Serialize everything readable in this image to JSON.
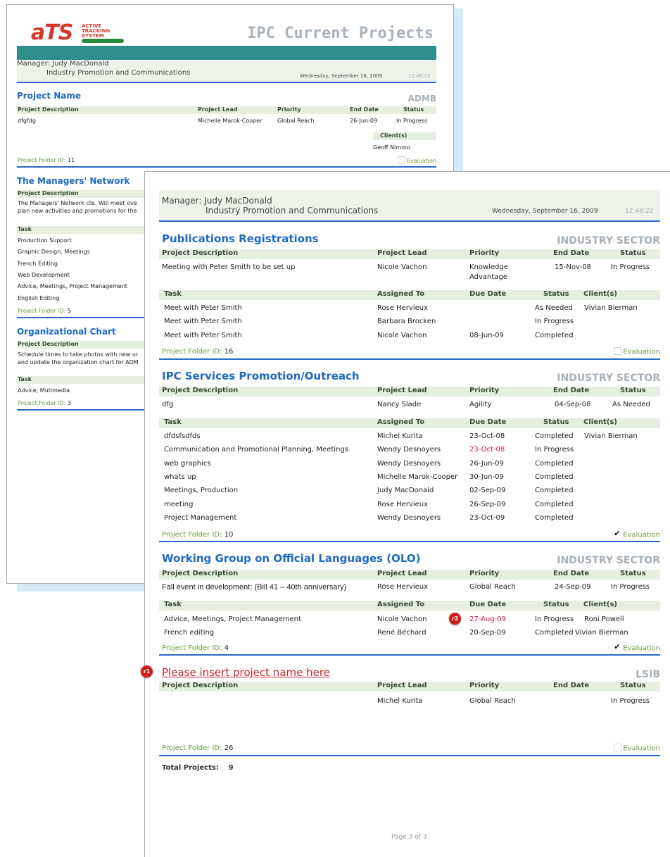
{
  "back": {
    "logo": {
      "brand": "aTS",
      "sub": [
        "ACTIVE",
        "TRACKING",
        "SYSTEM"
      ]
    },
    "title": "IPC Current Projects",
    "manager_label": "Manager:",
    "manager_name": "Judy MacDonald",
    "department": "Industry Promotion and Communications",
    "date": "Wednesday, September 16, 2009",
    "time": "12:48:15",
    "projects": [
      {
        "name": "Project Name",
        "sector": "ADMB",
        "headers": {
          "desc": "Project Description",
          "lead": "Project Lead",
          "priority": "Priority",
          "end": "End Date",
          "status": "Status"
        },
        "desc": "dfgfdg",
        "lead": "Michelle Marok-Cooper",
        "priority": "Global Reach",
        "end": "26-Jun-09",
        "status": "In Progress",
        "clients_label": "Client(s)",
        "client": "Geoff Nimmo",
        "folder_label": "Project Folder ID:",
        "folder": "11",
        "eval_label": "Evaluation"
      },
      {
        "name": "The Managers' Network",
        "desc_label": "Project Description",
        "desc": "The Managers' Network cte. Will meet ove",
        "desc2": "plan new activities and promotions for the",
        "task_label": "Task",
        "tasks": [
          "Production Support",
          "Graphic Design, Meetings",
          "French Editing",
          "Web Development",
          "Advice, Meetings, Project Management",
          "English Editing"
        ],
        "folder_label": "Project Folder ID:",
        "folder": "5"
      },
      {
        "name": "Organizational Chart",
        "desc_label": "Project Description",
        "desc": "Schedule times to take photos with new or",
        "desc2": "and update the organization chart for ADM",
        "task_label": "Task",
        "tasks": [
          "Advice, Mutimedia"
        ],
        "folder_label": "Project Folder ID:",
        "folder": "3"
      }
    ]
  },
  "front": {
    "manager_label": "Manager:",
    "manager_name": "Judy MacDonald",
    "department": "Industry Promotion and Communications",
    "date": "Wednesday, September 16, 2009",
    "time": "12:48:22",
    "headers": {
      "desc": "Project Description",
      "lead": "Project Lead",
      "priority": "Priority",
      "end": "End Date",
      "status": "Status"
    },
    "task_headers": {
      "task": "Task",
      "assigned": "Assigned To",
      "due": "Due Date",
      "status": "Status",
      "clients": "Client(s)"
    },
    "folder_label": "Project Folder ID:",
    "eval_label": "Evaluation",
    "p1": {
      "name": "Publications Registrations",
      "sector": "INDUSTRY SECTOR",
      "desc": "Meeting with Peter Smith to be set up",
      "lead": "Nicole Vachon",
      "priority": "Knowledge",
      "priority2": "Advantage",
      "end": "15-Nov-08",
      "status": "In Progress",
      "tasks": [
        {
          "task": "Meet with Peter Smith",
          "assigned": "Rose Hervieux",
          "due": "",
          "status": "As Needed",
          "client": "Vivian Bierman"
        },
        {
          "task": "Meet with Peter Smith",
          "assigned": "Barbara Brocken",
          "due": "",
          "status": "In Progress",
          "client": ""
        },
        {
          "task": "Meet with Peter Smith",
          "assigned": "Nicole Vachon",
          "due": "08-Jun-09",
          "status": "Completed",
          "client": ""
        }
      ],
      "folder": "16"
    },
    "p2": {
      "name": "IPC Services Promotion/Outreach",
      "sector": "INDUSTRY SECTOR",
      "desc": "dfg",
      "lead": "Nancy Slade",
      "priority": "Agility",
      "end": "04-Sep-08",
      "status": "As Needed",
      "tasks": [
        {
          "task": "dfdsfsdfds",
          "assigned": "Michel Kurita",
          "due": "23-Oct-08",
          "status": "Completed",
          "client": "Vivian Bierman"
        },
        {
          "task": "Communication and Promotional Planning, Meetings",
          "assigned": "Wendy Desnoyers",
          "due": "23-Oct-08",
          "status": "In Progress",
          "client": ""
        },
        {
          "task": "web graphics",
          "assigned": "Wendy Desnoyers",
          "due": "26-Jun-09",
          "status": "Completed",
          "client": ""
        },
        {
          "task": "whats up",
          "assigned": "Michelle Marok-Cooper",
          "due": "30-Jun-09",
          "status": "Completed",
          "client": ""
        },
        {
          "task": "Meetings, Production",
          "assigned": "Judy MacDonald",
          "due": "02-Sep-09",
          "status": "Completed",
          "client": ""
        },
        {
          "task": "meeting",
          "assigned": "Rose Hervieux",
          "due": "26-Sep-09",
          "status": "Completed",
          "client": ""
        },
        {
          "task": "Project Management",
          "assigned": "Wendy Desnoyers",
          "due": "23-Oct-09",
          "status": "Completed",
          "client": ""
        }
      ],
      "folder": "10"
    },
    "p3": {
      "name": "Working Group on Official Languages (OLO)",
      "sector": "INDUSTRY SECTOR",
      "desc": "Fall event in development: (Bill 41 – 40th anniversary)",
      "lead": "Rose Hervieux",
      "priority": "Global Reach",
      "end": "24-Sep-09",
      "status": "In Progress",
      "tasks": [
        {
          "task": "Advice, Meetings, Project Management",
          "assigned": "Nicole Vachon",
          "due": "27-Aug-09",
          "status": "In Progress",
          "client": "Roni Powell"
        },
        {
          "task": "French editing",
          "assigned": "René Béchard",
          "due": "20-Sep-09",
          "status": "Completed",
          "client": "Vivian Bierman"
        }
      ],
      "folder": "4"
    },
    "p4": {
      "name": "Please insert project name here",
      "sector": "LSIB",
      "desc": "",
      "lead": "Michel Kurita",
      "priority": "Global Reach",
      "end": "",
      "status": "In Progress",
      "folder": "26"
    },
    "markers": {
      "r1": "r1",
      "r2": "r2"
    },
    "total_label": "Total Projects:",
    "total": "9",
    "page": "Page 3 of 3"
  }
}
